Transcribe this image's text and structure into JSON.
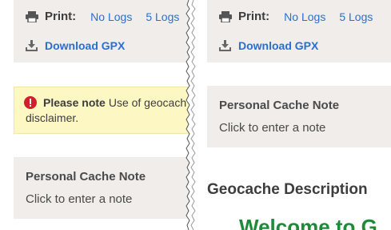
{
  "left": {
    "print": {
      "label": "Print:",
      "icon": "printer-icon",
      "no_logs": "No Logs",
      "five_logs": "5 Logs"
    },
    "download": {
      "icon": "download-icon",
      "label": "Download GPX"
    },
    "disclaimer": {
      "icon": "warning-icon",
      "title": "Please note",
      "text": "Use of geocach",
      "text2": "disclaimer.",
      "color": "#fdf7c3"
    },
    "personal_note": {
      "title": "Personal Cache Note",
      "click": "Click to enter a note"
    }
  },
  "right": {
    "print": {
      "label": "Print:",
      "icon": "printer-icon",
      "no_logs": "No Logs",
      "five_logs": "5 Logs"
    },
    "download": {
      "icon": "download-icon",
      "label": "Download GPX"
    },
    "personal_note": {
      "title": "Personal Cache Note",
      "click": "Click to enter a note"
    },
    "description_heading": "Geocache Description",
    "welcome_text": "Welcome to G"
  },
  "colors": {
    "link": "#2a6fcf",
    "panel": "#f0edea",
    "welcome": "#1f8a3a",
    "warning": "#d0202c"
  }
}
